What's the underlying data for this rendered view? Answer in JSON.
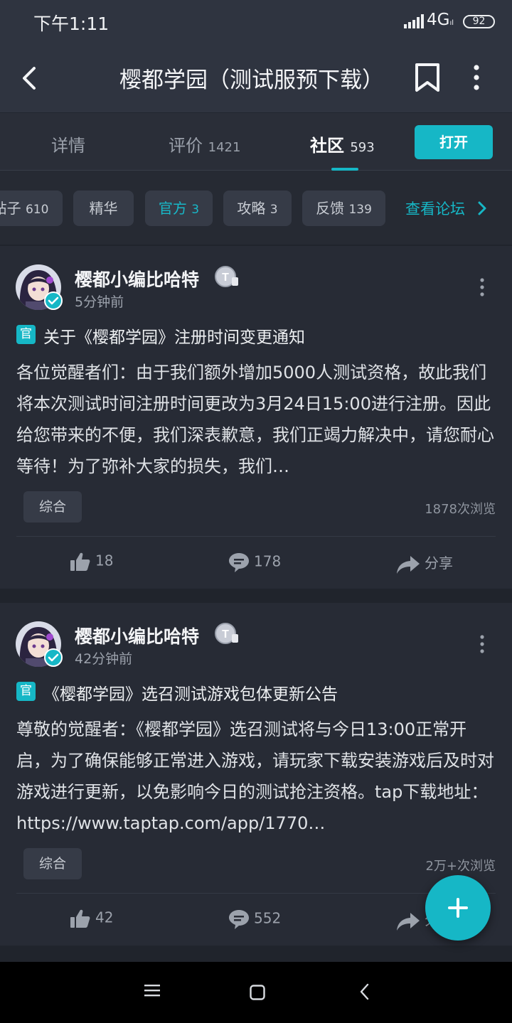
{
  "status_bar": {
    "time": "下午1:11",
    "network": "4G",
    "network_sub": "ıl",
    "battery": "92"
  },
  "app_bar": {
    "title": "樱都学园（测试服预下载）"
  },
  "tabs": [
    {
      "label": "详情",
      "count": ""
    },
    {
      "label": "评价",
      "count": "1421"
    },
    {
      "label": "社区",
      "count": "593"
    }
  ],
  "open_button": "打开",
  "filters": [
    {
      "label": "帖子",
      "count": "610"
    },
    {
      "label": "精华",
      "count": ""
    },
    {
      "label": "官方",
      "count": "3"
    },
    {
      "label": "攻略",
      "count": "3"
    },
    {
      "label": "反馈",
      "count": "139"
    }
  ],
  "forum_link": "查看论坛",
  "posts": [
    {
      "author": "樱都小编比哈特",
      "time": "5分钟前",
      "tag": "官",
      "title": "关于《樱都学园》注册时间变更通知",
      "body": "各位觉醒者们：由于我们额外增加5000人测试资格，故此我们将本次测试时间注册时间更改为3月24日15:00进行注册。因此给您带来的不便，我们深表歉意，我们正竭力解决中，请您耐心等待！为了弥补大家的损失，我们…",
      "category": "综合",
      "views": "1878次浏览",
      "likes": "18",
      "comments": "178",
      "share": "分享"
    },
    {
      "author": "樱都小编比哈特",
      "time": "42分钟前",
      "tag": "官",
      "title": "《樱都学园》选召测试游戏包体更新公告",
      "body": "尊敬的觉醒者：《樱都学园》选召测试将与今日13:00正常开启，为了确保能够正常进入游戏，请玩家下载安装游戏后及时对游戏进行更新，以免影响今日的测试抢注资格。tap下载地址：https://www.taptap.com/app/1770…",
      "category": "综合",
      "views": "2万+次浏览",
      "likes": "42",
      "comments": "552",
      "share": "分享"
    }
  ],
  "colors": {
    "accent": "#16b7c6",
    "background": "#262a33",
    "header": "#2f3440"
  },
  "icons": [
    "back-icon",
    "bookmark-icon",
    "more-icon",
    "chevron-right-icon",
    "like-icon",
    "comment-icon",
    "share-icon",
    "plus-icon",
    "verified-icon",
    "level-icon"
  ]
}
